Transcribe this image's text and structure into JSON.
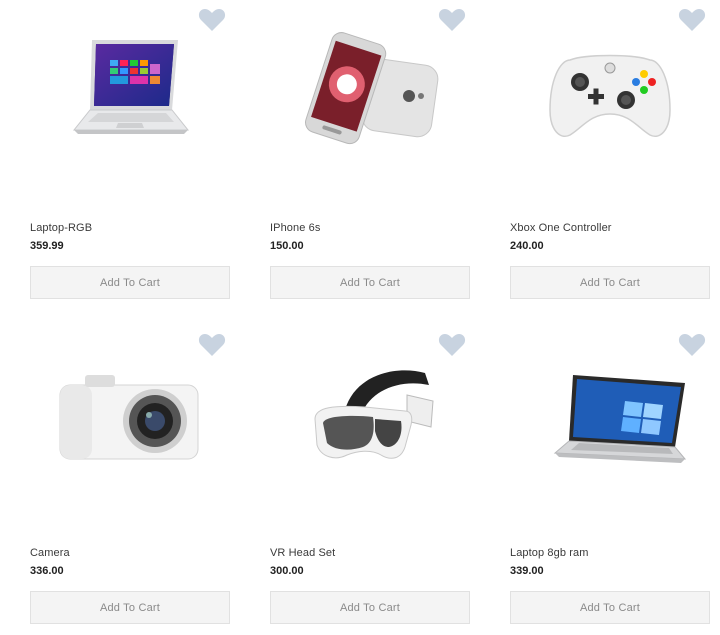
{
  "colors": {
    "heart": "#c8d3e0",
    "button_bg": "#f4f4f4",
    "button_border": "#e1e1e1",
    "button_text": "#8a8a8a"
  },
  "products": [
    {
      "name": "Laptop-RGB",
      "price": "359.99",
      "image": "laptop-icon",
      "cta": "Add To Cart"
    },
    {
      "name": "IPhone 6s",
      "price": "150.00",
      "image": "smartphone-icon",
      "cta": "Add To Cart"
    },
    {
      "name": "Xbox One Controller",
      "price": "240.00",
      "image": "gamepad-icon",
      "cta": "Add To Cart"
    },
    {
      "name": "Camera",
      "price": "336.00",
      "image": "camera-icon",
      "cta": "Add To Cart"
    },
    {
      "name": "VR Head Set",
      "price": "300.00",
      "image": "vr-headset-icon",
      "cta": "Add To Cart"
    },
    {
      "name": "Laptop 8gb ram",
      "price": "339.00",
      "image": "laptop-icon",
      "cta": "Add To Cart"
    }
  ]
}
